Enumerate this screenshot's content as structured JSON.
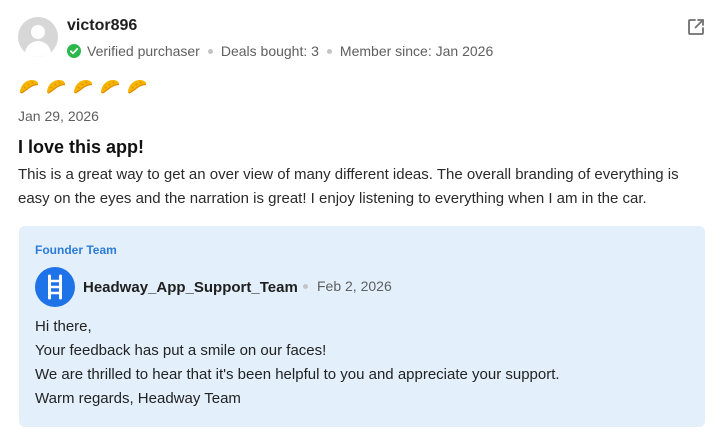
{
  "reviewer": {
    "username": "victor896",
    "verified_label": "Verified purchaser",
    "deals_bought": "Deals bought: 3",
    "member_since": "Member since: Jan 2026"
  },
  "review": {
    "rating": 5,
    "date": "Jan 29, 2026",
    "title": "I love this app!",
    "body": "This is a great way to get an over view of many different ideas. The overall branding of everything is easy on the eyes and the narration is great! I enjoy listening to everything when I am in the car."
  },
  "reply": {
    "label": "Founder Team",
    "author": "Headway_App_Support_Team",
    "date": "Feb 2, 2026",
    "lines": [
      "Hi there,",
      "Your feedback has put a smile on our faces!",
      "We are thrilled to hear that it's been helpful to you and appreciate your support.",
      "Warm regards, Headway Team"
    ]
  },
  "colors": {
    "verified_green": "#2db84d",
    "rating_yellow": "#f5b400",
    "reply_background": "#e3f0fb",
    "brand_blue": "#1e73e8",
    "label_blue": "#2b7bd8"
  },
  "icons": {
    "external_link": "external-link-icon",
    "verified": "check-circle-icon",
    "rating": "taco-icon",
    "brand": "ladder-logo-icon"
  }
}
